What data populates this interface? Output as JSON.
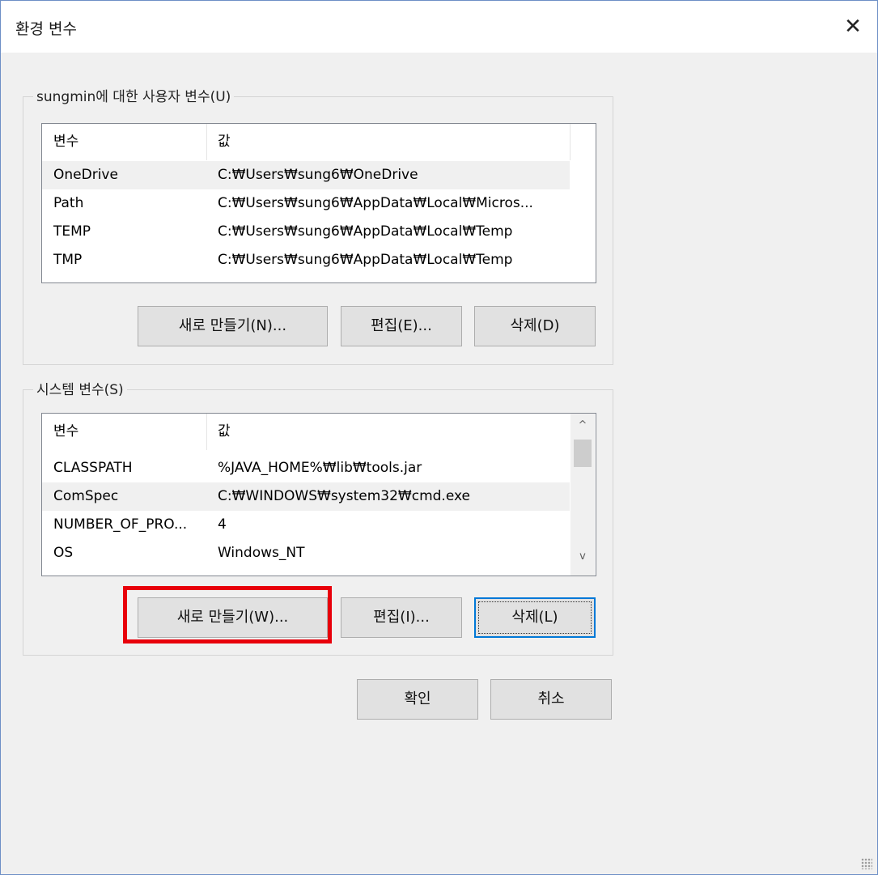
{
  "window": {
    "title": "환경 변수",
    "close_glyph": "✕"
  },
  "user_vars": {
    "group_title": "sungmin에 대한 사용자 변수(U)",
    "columns": [
      "변수",
      "값"
    ],
    "rows": [
      {
        "name": "OneDrive",
        "value": "C:₩Users₩sung6₩OneDrive"
      },
      {
        "name": "Path",
        "value": "C:₩Users₩sung6₩AppData₩Local₩Micros..."
      },
      {
        "name": "TEMP",
        "value": "C:₩Users₩sung6₩AppData₩Local₩Temp"
      },
      {
        "name": "TMP",
        "value": "C:₩Users₩sung6₩AppData₩Local₩Temp"
      }
    ],
    "selected_row": "OneDrive",
    "buttons": {
      "new": "새로 만들기(N)...",
      "edit": "편집(E)...",
      "delete": "삭제(D)"
    }
  },
  "system_vars": {
    "group_title": "시스템 변수(S)",
    "columns": [
      "변수",
      "값"
    ],
    "rows": [
      {
        "name": "CLASSPATH",
        "value": "%JAVA_HOME%₩lib₩tools.jar"
      },
      {
        "name": "ComSpec",
        "value": "C:₩WINDOWS₩system32₩cmd.exe"
      },
      {
        "name": "NUMBER_OF_PRO...",
        "value": "4"
      },
      {
        "name": "OS",
        "value": "Windows_NT"
      }
    ],
    "selected_row": "ComSpec",
    "buttons": {
      "new": "새로 만들기(W)...",
      "edit": "편집(I)...",
      "delete": "삭제(L)"
    }
  },
  "dialog_buttons": {
    "ok": "확인",
    "cancel": "취소"
  },
  "icons": {
    "close": "close-icon",
    "scroll_up": "chevron-up-icon",
    "scroll_down": "chevron-down-icon",
    "scroll_up_glyph": "^",
    "scroll_down_glyph": "v"
  },
  "colors": {
    "window_bg": "#f0f0f0",
    "list_bg": "#ffffff",
    "button_bg": "#e1e1e1",
    "default_button_border": "#0078d7",
    "highlight_border": "#e8000b",
    "window_border": "#6d8fc6"
  }
}
